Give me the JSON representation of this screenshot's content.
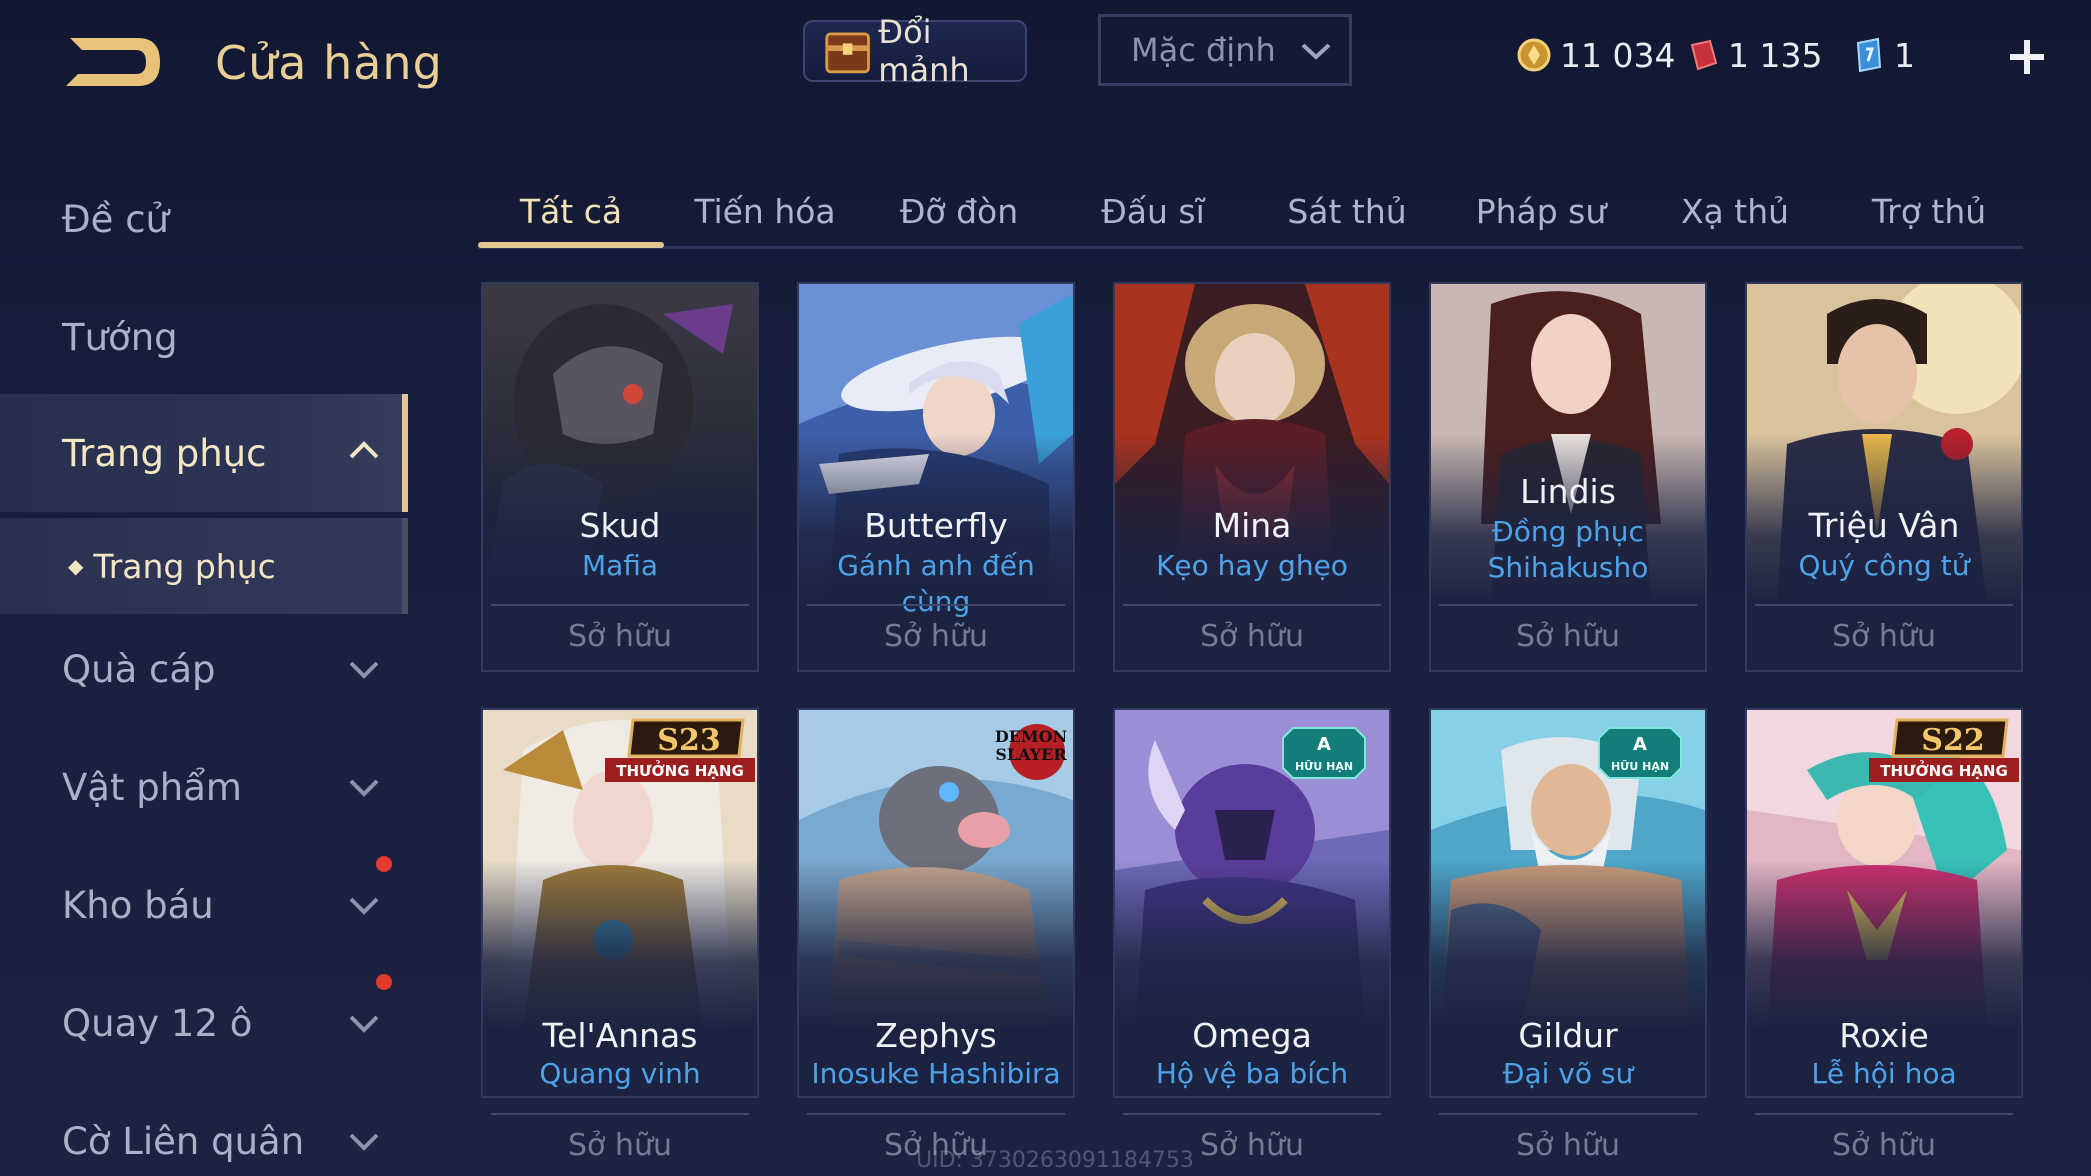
{
  "header": {
    "title": "Cửa hàng",
    "exchange_label": "Đổi mảnh",
    "sort_value": "Mặc định",
    "currencies": [
      {
        "icon": "gold-coin-icon",
        "value": "11 034"
      },
      {
        "icon": "red-voucher-icon",
        "value": "1 135"
      },
      {
        "icon": "blue-ticket-icon",
        "value": "1"
      }
    ]
  },
  "sidebar": {
    "items": [
      {
        "label": "Đề cử"
      },
      {
        "label": "Tướng"
      },
      {
        "label": "Trang phục"
      },
      {
        "label": "Quà cáp"
      },
      {
        "label": "Vật phẩm"
      },
      {
        "label": "Kho báu"
      },
      {
        "label": "Quay 12 ô"
      },
      {
        "label": "Cờ Liên quân"
      }
    ],
    "sub_item": "Trang phục"
  },
  "tabs": [
    "Tất cả",
    "Tiến hóa",
    "Đỡ đòn",
    "Đấu sĩ",
    "Sát thủ",
    "Pháp sư",
    "Xạ thủ",
    "Trợ thủ"
  ],
  "cards": [
    {
      "hero": "Skud",
      "skin": "Mafia",
      "status": "Sở hữu"
    },
    {
      "hero": "Butterfly",
      "skin": "Gánh anh đến cùng",
      "status": "Sở hữu"
    },
    {
      "hero": "Mina",
      "skin": "Kẹo hay ghẹo",
      "status": "Sở hữu"
    },
    {
      "hero": "Lindis",
      "skin": "Đồng phục Shihakusho",
      "skin_line1": "Đồng phục",
      "skin_line2": "Shihakusho",
      "status": "Sở hữu"
    },
    {
      "hero": "Triệu Vân",
      "skin": "Quý công tử",
      "status": "Sở hữu"
    },
    {
      "hero": "Tel'Annas",
      "skin": "Quang vinh",
      "status": "Sở hữu",
      "badge": "S23",
      "badge_text": "THƯỞNG HẠNG"
    },
    {
      "hero": "Zephys",
      "skin": "Inosuke Hashibira",
      "status": "Sở hữu",
      "badge_line1": "DEMON",
      "badge_line2": "SLAYER"
    },
    {
      "hero": "Omega",
      "skin": "Hộ vệ ba bích",
      "status": "Sở hữu",
      "badge": "A",
      "badge_text": "HỮU HẠN"
    },
    {
      "hero": "Gildur",
      "skin": "Đại võ sư",
      "status": "Sở hữu",
      "badge": "A",
      "badge_text": "HỮU HẠN"
    },
    {
      "hero": "Roxie",
      "skin": "Lễ hội hoa",
      "status": "Sở hữu",
      "badge": "S22",
      "badge_text": "THƯỞNG HẠNG"
    }
  ],
  "uid": "UID: 3730263091184753",
  "colors": {
    "accent_gold": "#e1c78f",
    "skin_blue": "#4da2e8",
    "notification_red": "#e23a2b"
  }
}
